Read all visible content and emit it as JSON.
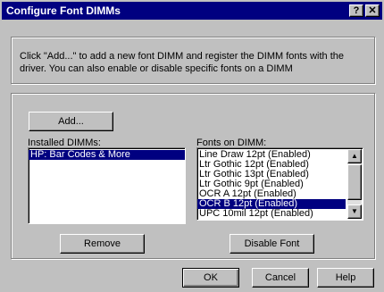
{
  "window": {
    "title": "Configure Font DIMMs",
    "help_glyph": "?",
    "close_glyph": "✕"
  },
  "description": "Click \"Add...\" to add a new font DIMM and register the DIMM fonts with the driver. You can also enable or disable specific fonts on a DIMM",
  "add_label": "Add...",
  "installed": {
    "label": "Installed DIMMs:",
    "items": [
      "HP: Bar Codes & More"
    ],
    "selected_index": 0
  },
  "fonts": {
    "label": "Fonts on DIMM:",
    "items": [
      "Line Draw 12pt (Enabled)",
      "Ltr Gothic 12pt (Enabled)",
      "Ltr Gothic 13pt (Enabled)",
      "Ltr Gothic 9pt (Enabled)",
      "OCR A 12pt (Enabled)",
      "OCR B 12pt (Enabled)",
      "UPC 10mil 12pt (Enabled)"
    ],
    "selected_index": 5,
    "scroll_up_glyph": "▲",
    "scroll_down_glyph": "▼"
  },
  "remove_label": "Remove",
  "disable_font_label": "Disable Font",
  "footer": {
    "ok_label": "OK",
    "cancel_label": "Cancel",
    "help_label": "Help"
  }
}
